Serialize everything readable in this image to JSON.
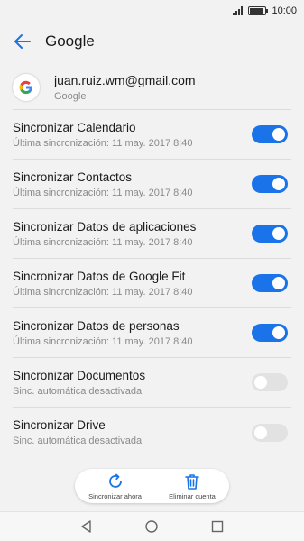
{
  "status_bar": {
    "time": "10:00",
    "battery_level": 0.9
  },
  "app_bar": {
    "title": "Google"
  },
  "account": {
    "email": "juan.ruiz.wm@gmail.com",
    "provider": "Google"
  },
  "sync_items": [
    {
      "title": "Sincronizar Calendario",
      "subtitle": "Última sincronización: 11 may. 2017 8:40",
      "enabled": true
    },
    {
      "title": "Sincronizar Contactos",
      "subtitle": "Última sincronización: 11 may. 2017 8:40",
      "enabled": true
    },
    {
      "title": "Sincronizar Datos de aplicaciones",
      "subtitle": "Última sincronización: 11 may. 2017 8:40",
      "enabled": true
    },
    {
      "title": "Sincronizar Datos de Google Fit",
      "subtitle": "Última sincronización: 11 may. 2017 8:40",
      "enabled": true
    },
    {
      "title": "Sincronizar Datos de personas",
      "subtitle": "Última sincronización: 11 may. 2017 8:40",
      "enabled": true
    },
    {
      "title": "Sincronizar Documentos",
      "subtitle": "Sinc. automática desactivada",
      "enabled": false
    },
    {
      "title": "Sincronizar Drive",
      "subtitle": "Sinc. automática desactivada",
      "enabled": false
    }
  ],
  "actions": {
    "sync_now": "Sincronizar ahora",
    "delete_account": "Eliminar cuenta"
  },
  "colors": {
    "accent": "#1a73e8",
    "toggle_off": "#e2e2e2",
    "background": "#f2f2f2"
  },
  "icons": {
    "back": "arrow-left-icon",
    "sync": "sync-icon",
    "delete": "trash-icon"
  }
}
